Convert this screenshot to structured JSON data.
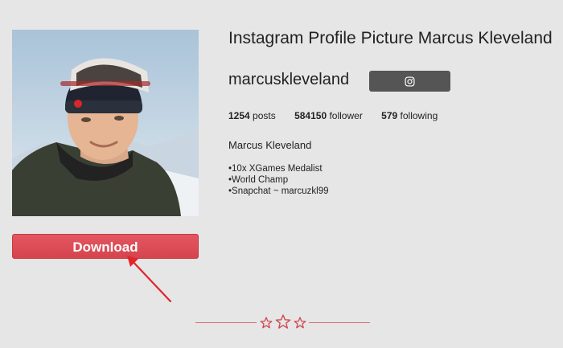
{
  "profile": {
    "title": "Instagram Profile Picture Marcus Kleveland",
    "username": "marcuskleveland",
    "full_name": "Marcus Kleveland",
    "stats": {
      "posts_count": "1254",
      "posts_label": "posts",
      "followers_count": "584150",
      "followers_label": "follower",
      "following_count": "579",
      "following_label": "following"
    },
    "bio": [
      "•10x XGames Medalist",
      "•World Champ",
      "•Snapchat ~ marcuzkl99"
    ]
  },
  "actions": {
    "download_label": "Download",
    "instagram_icon": "instagram-icon"
  },
  "decor": {
    "star_icon": "star-outline-icon"
  },
  "colors": {
    "background": "#e6e6e6",
    "download_button": "#d94a54",
    "instagram_button": "#555555",
    "annotation_arrow": "#e0252c",
    "divider": "#d76b6e"
  }
}
